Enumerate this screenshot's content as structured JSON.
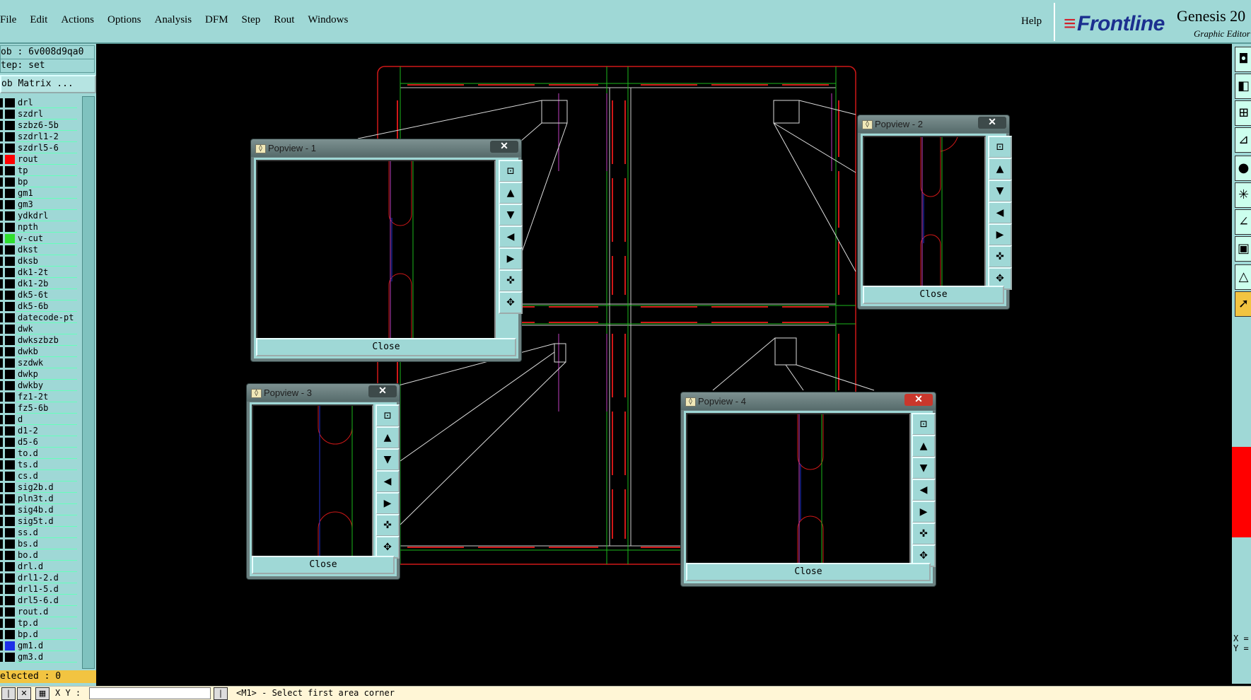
{
  "menu": [
    "File",
    "Edit",
    "Actions",
    "Options",
    "Analysis",
    "DFM",
    "Step",
    "Rout",
    "Windows"
  ],
  "help": "Help",
  "brand": {
    "logo": "Frontline",
    "product": "Genesis 20",
    "subtitle": "Graphic Editor"
  },
  "job": {
    "job": "ob : 6v008d9qa0",
    "step": "tep: set",
    "matrix": "ob Matrix ..."
  },
  "layers": [
    {
      "name": "drl",
      "color": "#000000"
    },
    {
      "name": "szdrl",
      "color": "#000000"
    },
    {
      "name": "szbz6-5b",
      "color": "#000000"
    },
    {
      "name": "szdrl1-2",
      "color": "#000000"
    },
    {
      "name": "szdrl5-6",
      "color": "#000000"
    },
    {
      "name": "rout",
      "color": "#ff0000"
    },
    {
      "name": "tp",
      "color": "#000000"
    },
    {
      "name": "bp",
      "color": "#000000"
    },
    {
      "name": "gm1",
      "color": "#000000"
    },
    {
      "name": "gm3",
      "color": "#000000"
    },
    {
      "name": "ydkdrl",
      "color": "#000000"
    },
    {
      "name": "npth",
      "color": "#000000"
    },
    {
      "name": "v-cut",
      "color": "#2ee02e"
    },
    {
      "name": "dkst",
      "color": "#000000"
    },
    {
      "name": "dksb",
      "color": "#000000"
    },
    {
      "name": "dk1-2t",
      "color": "#000000"
    },
    {
      "name": "dk1-2b",
      "color": "#000000"
    },
    {
      "name": "dk5-6t",
      "color": "#000000"
    },
    {
      "name": "dk5-6b",
      "color": "#000000"
    },
    {
      "name": "datecode-pt",
      "color": "#000000"
    },
    {
      "name": "dwk",
      "color": "#000000"
    },
    {
      "name": "dwkszbzb",
      "color": "#000000"
    },
    {
      "name": "dwkb",
      "color": "#000000"
    },
    {
      "name": "szdwk",
      "color": "#000000"
    },
    {
      "name": "dwkp",
      "color": "#000000"
    },
    {
      "name": "dwkby",
      "color": "#000000"
    },
    {
      "name": "fz1-2t",
      "color": "#000000"
    },
    {
      "name": "fz5-6b",
      "color": "#000000"
    },
    {
      "name": "d",
      "color": "#000000"
    },
    {
      "name": "d1-2",
      "color": "#000000"
    },
    {
      "name": "d5-6",
      "color": "#000000"
    },
    {
      "name": "to.d",
      "color": "#000000"
    },
    {
      "name": "ts.d",
      "color": "#000000"
    },
    {
      "name": "cs.d",
      "color": "#000000"
    },
    {
      "name": "sig2b.d",
      "color": "#000000"
    },
    {
      "name": "pln3t.d",
      "color": "#000000"
    },
    {
      "name": "sig4b.d",
      "color": "#000000"
    },
    {
      "name": "sig5t.d",
      "color": "#000000"
    },
    {
      "name": "ss.d",
      "color": "#000000"
    },
    {
      "name": "bs.d",
      "color": "#000000"
    },
    {
      "name": "bo.d",
      "color": "#000000"
    },
    {
      "name": "drl.d",
      "color": "#000000"
    },
    {
      "name": "drl1-2.d",
      "color": "#000000"
    },
    {
      "name": "drl1-5.d",
      "color": "#000000"
    },
    {
      "name": "drl5-6.d",
      "color": "#000000"
    },
    {
      "name": "rout.d",
      "color": "#000000"
    },
    {
      "name": "tp.d",
      "color": "#000000"
    },
    {
      "name": "bp.d",
      "color": "#000000"
    },
    {
      "name": "gm1.d",
      "color": "#1c2ee8"
    },
    {
      "name": "gm3.d",
      "color": "#000000"
    }
  ],
  "status": {
    "selected": "elected : 0"
  },
  "bottom": {
    "coord_label": "X Y :",
    "message": "<M1> - Select first area corner"
  },
  "right": {
    "x_label": "X =",
    "y_label": "Y ="
  },
  "popviews": [
    {
      "title": "Popview - 1",
      "close": "Close"
    },
    {
      "title": "Popview - 2",
      "close": "Close"
    },
    {
      "title": "Popview - 3",
      "close": "Close"
    },
    {
      "title": "Popview - 4",
      "close": "Close"
    }
  ],
  "close_glyph": "✕",
  "colors": {
    "panel": "#9fd8d6",
    "rout": "#ff0000",
    "vcut": "#2ee02e",
    "status": "#f2c441"
  }
}
